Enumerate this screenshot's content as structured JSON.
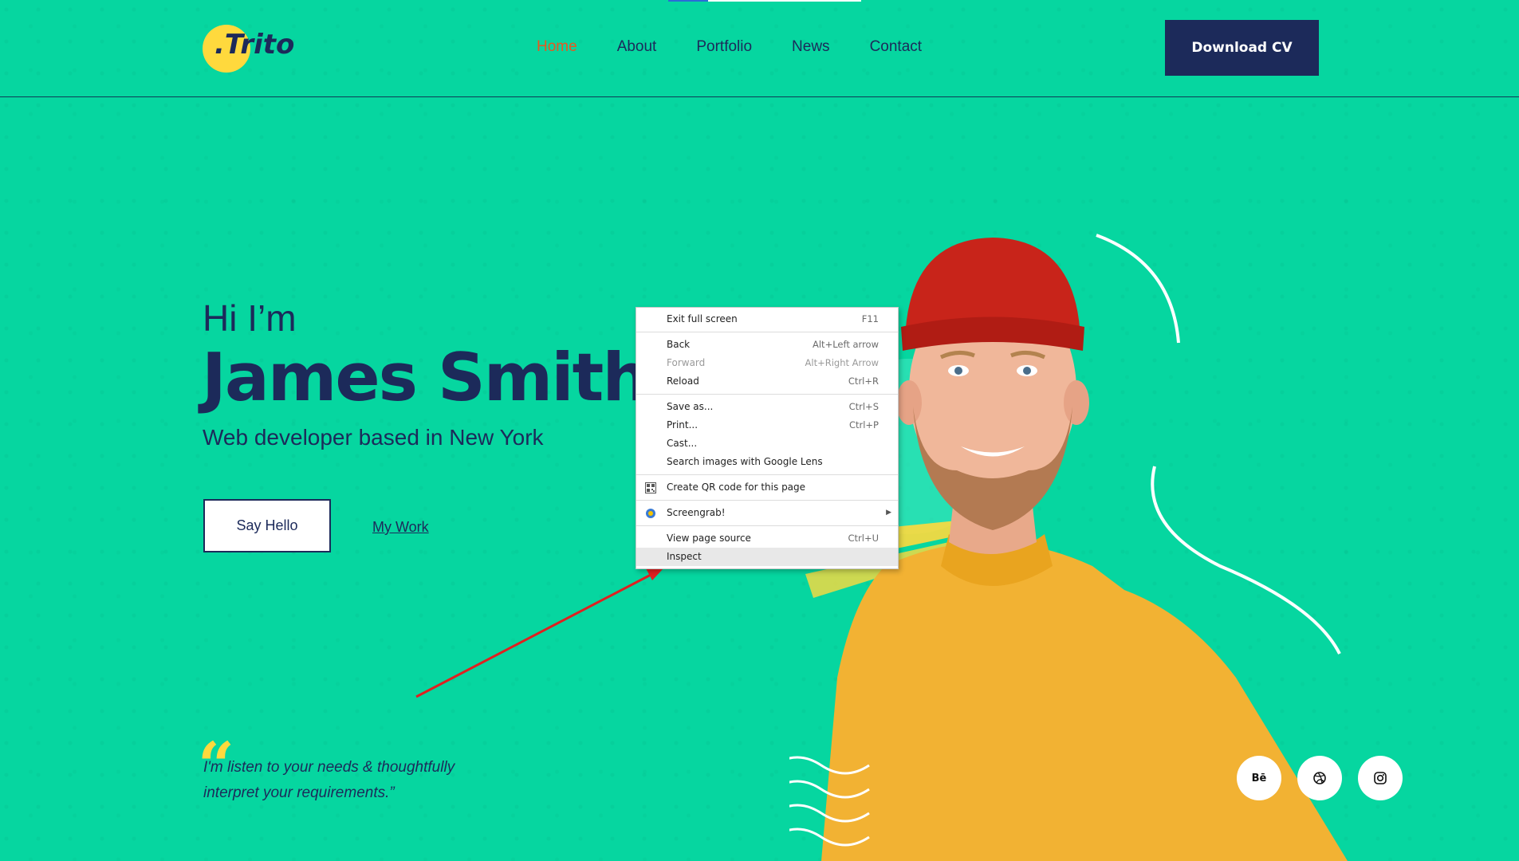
{
  "brand": {
    "logo_text": ".Trito"
  },
  "nav": {
    "items": [
      {
        "label": "Home",
        "active": true
      },
      {
        "label": "About"
      },
      {
        "label": "Portfolio"
      },
      {
        "label": "News"
      },
      {
        "label": "Contact"
      }
    ]
  },
  "header": {
    "cta_label": "Download CV"
  },
  "hero": {
    "greeting": "Hi I’m",
    "name": "James Smith",
    "subtitle": "Web developer based in New York",
    "primary_button": "Say Hello",
    "secondary_link": "My Work"
  },
  "quote": {
    "mark": "“",
    "text": "I'm listen to your needs & thoughtfully interpret your requirements.”"
  },
  "social": [
    {
      "label": "Bē",
      "icon": "behance-icon"
    },
    {
      "label": "",
      "icon": "dribbble-icon"
    },
    {
      "label": "",
      "icon": "instagram-icon"
    }
  ],
  "context_menu": {
    "items": [
      {
        "label": "Exit full screen",
        "shortcut": "F11"
      },
      {
        "sep": true
      },
      {
        "label": "Back",
        "shortcut": "Alt+Left arrow"
      },
      {
        "label": "Forward",
        "shortcut": "Alt+Right Arrow",
        "disabled": true
      },
      {
        "label": "Reload",
        "shortcut": "Ctrl+R"
      },
      {
        "sep": true
      },
      {
        "label": "Save as...",
        "shortcut": "Ctrl+S"
      },
      {
        "label": "Print...",
        "shortcut": "Ctrl+P"
      },
      {
        "label": "Cast...",
        "shortcut": ""
      },
      {
        "label": "Search images with Google Lens",
        "shortcut": ""
      },
      {
        "sep": true
      },
      {
        "label": "Create QR code for this page",
        "icon": "qr-code-icon"
      },
      {
        "sep": true
      },
      {
        "label": "Screengrab!",
        "icon": "screengrab-icon",
        "submenu": true
      },
      {
        "sep": true
      },
      {
        "label": "View page source",
        "shortcut": "Ctrl+U"
      },
      {
        "label": "Inspect",
        "shortcut": "",
        "highlighted": true
      }
    ]
  },
  "colors": {
    "background": "#06d6a0",
    "navy": "#1c2a5a",
    "active_nav": "#e8571f",
    "accent_yellow": "#ffd93d",
    "annotation_arrow": "#e02020"
  }
}
